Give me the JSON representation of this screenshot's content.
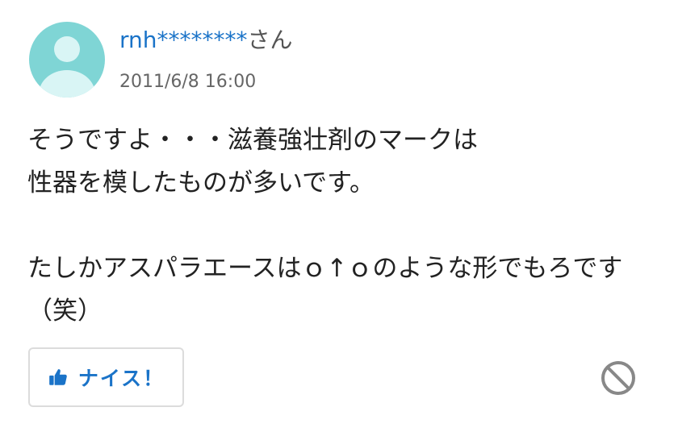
{
  "answer": {
    "username": "rnh********",
    "honorific": "さん",
    "timestamp": "2011/6/8 16:00",
    "body_lines": [
      "そうですよ・・・滋養強壮剤のマークは",
      "性器を模したものが多いです。",
      "",
      "たしかアスパラエースはｏ↑ｏのような形でもろです",
      "（笑）"
    ]
  },
  "actions": {
    "nice_label": "ナイス！",
    "nice_icon": "thumbs-up-icon",
    "block_icon": "prohibited-icon"
  },
  "colors": {
    "accent": "#1a73c8",
    "avatar_bg": "#7fd5d5",
    "avatar_fg": "#d9f5f5",
    "text": "#222222",
    "muted": "#666666"
  }
}
